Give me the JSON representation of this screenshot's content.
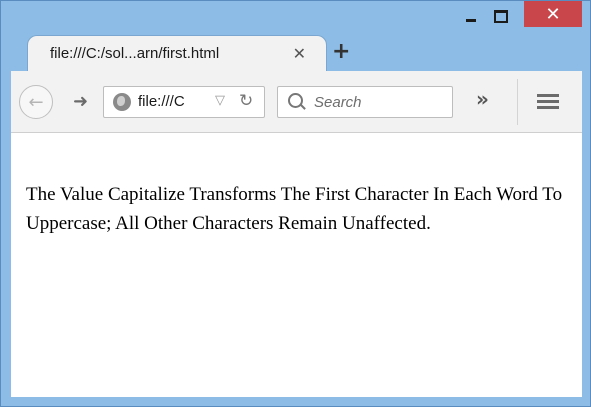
{
  "window": {
    "controls": {
      "minimize": "",
      "maximize": "",
      "close": "✕"
    }
  },
  "tab": {
    "title": "file:///C:/sol...arn/first.html",
    "close_glyph": "✕",
    "new_tab_glyph": "+"
  },
  "toolbar": {
    "back_glyph": "←",
    "forward_glyph": "➜",
    "url": "file:///C",
    "dropmark_glyph": "▽",
    "reload_glyph": "↻",
    "search_placeholder": "Search",
    "overflow_glyph": "»"
  },
  "page": {
    "text": "The Value Capitalize Transforms The First Character In Each Word To Uppercase; All Other Characters Remain Unaffected."
  },
  "colors": {
    "chrome": "#8dbde6",
    "close": "#c9464b",
    "toolbar": "#f2f2f2"
  }
}
